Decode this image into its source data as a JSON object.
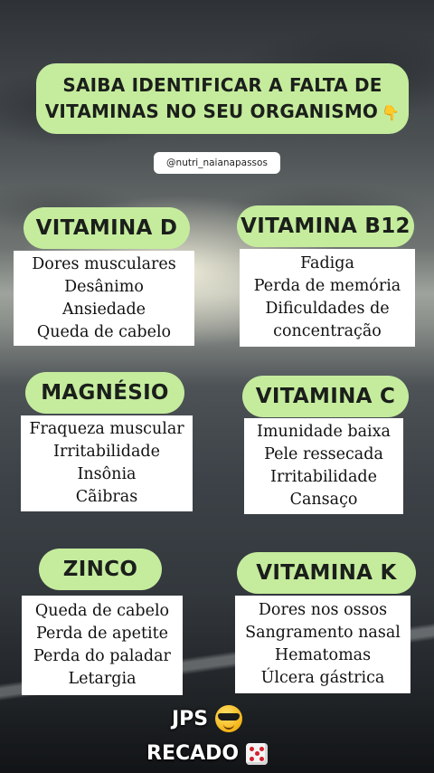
{
  "title": {
    "line1": "SAIBA IDENTIFICAR A FALTA DE",
    "line2": "VITAMINAS NO SEU ORGANISMO",
    "pointer_icon": "pointing-down-hand-emoji"
  },
  "handle": "@nutri_naianapassos",
  "cards": [
    {
      "name": "VITAMINA D",
      "symptoms": [
        "Dores musculares",
        "Desânimo",
        "Ansiedade",
        "Queda de cabelo"
      ]
    },
    {
      "name": "VITAMINA B12",
      "symptoms": [
        "Fadiga",
        "Perda de memória",
        "Dificuldades de",
        "concentração"
      ]
    },
    {
      "name": "MAGNÉSIO",
      "symptoms": [
        "Fraqueza muscular",
        "Irritabilidade",
        "Insônia",
        "Cãibras"
      ]
    },
    {
      "name": "VITAMINA C",
      "symptoms": [
        "Imunidade baixa",
        "Pele ressecada",
        "Irritabilidade",
        "Cansaço"
      ]
    },
    {
      "name": "ZINCO",
      "symptoms": [
        "Queda de cabelo",
        "Perda de apetite",
        "Perda do paladar",
        "Letargia"
      ]
    },
    {
      "name": "VITAMINA K",
      "symptoms": [
        "Dores nos ossos",
        "Sangramento nasal",
        "Hematomas",
        "Úlcera gástrica"
      ]
    }
  ],
  "footer": {
    "line1": "JPS",
    "line1_icon": "sunglasses-emoji",
    "line2": "RECADO",
    "line2_icon": "dice-emoji"
  },
  "colors": {
    "pill": "#c5ec9d",
    "card": "#ffffff"
  }
}
